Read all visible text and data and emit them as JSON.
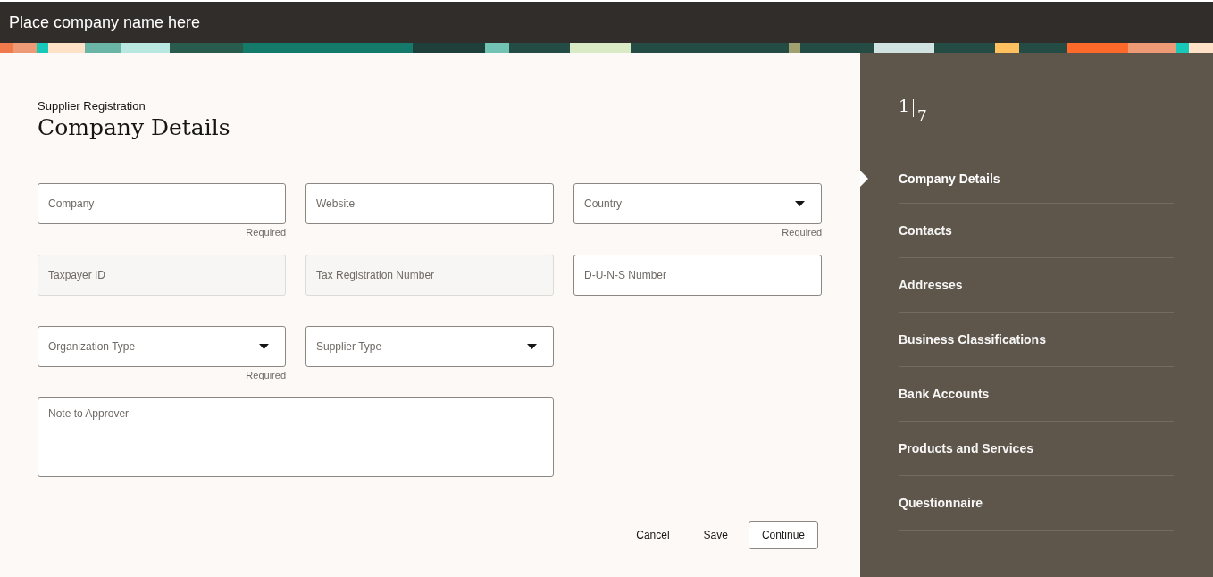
{
  "header": {
    "company_name": "Place company name here"
  },
  "page": {
    "breadcrumb": "Supplier Registration",
    "title": "Company Details"
  },
  "fields": [
    {
      "kind": "text",
      "placeholder": "Company",
      "required": true,
      "disabled": false,
      "hint": "Required"
    },
    {
      "kind": "text",
      "placeholder": "Website",
      "required": false,
      "disabled": false
    },
    {
      "kind": "select",
      "label": "Country",
      "required": true,
      "disabled": false,
      "hint": "Required"
    },
    {
      "kind": "text",
      "placeholder": "Taxpayer ID",
      "required": false,
      "disabled": true
    },
    {
      "kind": "text",
      "placeholder": "Tax Registration Number",
      "required": false,
      "disabled": true
    },
    {
      "kind": "text",
      "placeholder": "D-U-N-S Number",
      "required": false,
      "disabled": false
    },
    {
      "kind": "select",
      "label": "Organization Type",
      "required": true,
      "disabled": false,
      "hint": "Required"
    },
    {
      "kind": "select",
      "label": "Supplier Type",
      "required": false,
      "disabled": false
    },
    {
      "kind": "textarea",
      "placeholder": "Note to Approver",
      "required": false,
      "disabled": false
    }
  ],
  "actions": [
    {
      "label": "Cancel",
      "kind": "plain"
    },
    {
      "label": "Save",
      "kind": "plain"
    },
    {
      "label": "Continue",
      "kind": "outlined"
    }
  ],
  "progress": {
    "current": "1",
    "total": "7"
  },
  "steps": [
    {
      "label": "Company Details",
      "selected": true
    },
    {
      "label": "Contacts",
      "selected": false
    },
    {
      "label": "Addresses",
      "selected": false
    },
    {
      "label": "Business Classifications",
      "selected": false
    },
    {
      "label": "Bank Accounts",
      "selected": false
    },
    {
      "label": "Products and Services",
      "selected": false
    },
    {
      "label": "Questionnaire",
      "selected": false
    }
  ]
}
